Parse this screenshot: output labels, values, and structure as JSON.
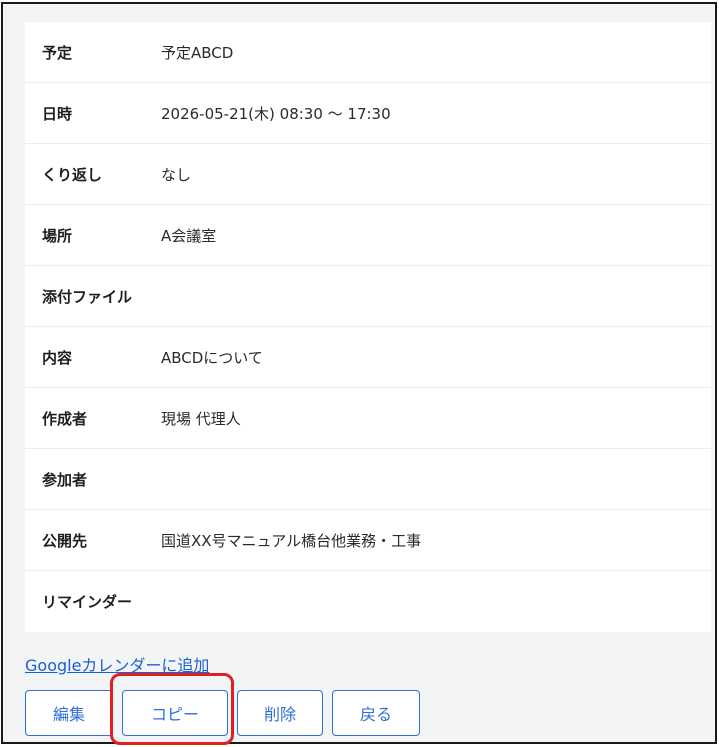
{
  "details": [
    {
      "label": "予定",
      "value": "予定ABCD"
    },
    {
      "label": "日時",
      "value": "2026-05-21(木) 08:30 ～ 17:30"
    },
    {
      "label": "くり返し",
      "value": "なし"
    },
    {
      "label": "場所",
      "value": "A会議室"
    },
    {
      "label": "添付ファイル",
      "value": ""
    },
    {
      "label": "内容",
      "value": "ABCDについて"
    },
    {
      "label": "作成者",
      "value": "現場 代理人"
    },
    {
      "label": "参加者",
      "value": ""
    },
    {
      "label": "公開先",
      "value": "国道XX号マニュアル橋台他業務・工事"
    },
    {
      "label": "リマインダー",
      "value": ""
    }
  ],
  "links": {
    "google_calendar": "Googleカレンダーに追加"
  },
  "buttons": {
    "edit": "編集",
    "copy": "コピー",
    "delete": "削除",
    "back": "戻る"
  },
  "colors": {
    "accent": "#2f6fd6",
    "link": "#1a5fd6",
    "highlight": "#e02020"
  }
}
